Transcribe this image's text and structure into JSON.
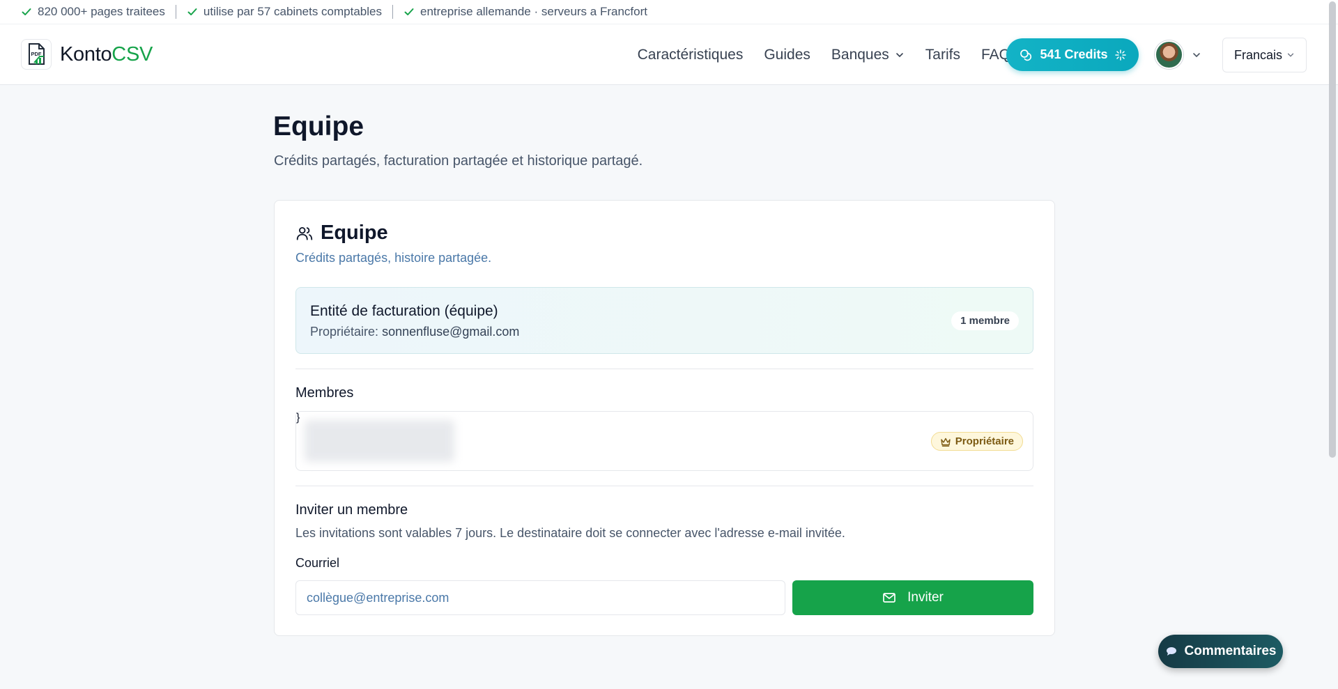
{
  "trustbar": {
    "items": [
      "820 000+ pages traitees",
      "utilise par 57 cabinets comptables",
      "entreprise allemande · serveurs a Francfort"
    ]
  },
  "header": {
    "logo": {
      "part1": "Konto",
      "part2": "CSV",
      "mark": "PDF"
    },
    "nav": [
      {
        "label": "Caractéristiques"
      },
      {
        "label": "Guides"
      },
      {
        "label": "Banques"
      },
      {
        "label": "Tarifs"
      },
      {
        "label": "FAQ"
      }
    ],
    "credits_label": "541 Credits",
    "language": "Francais"
  },
  "page": {
    "title": "Equipe",
    "subtitle": "Crédits partagés, facturation partagée et historique partagé."
  },
  "card": {
    "title": "Equipe",
    "subtitle": "Crédits partagés, histoire partagée.",
    "billing": {
      "title": "Entité de facturation (équipe)",
      "owner_label": "Propriétaire:",
      "owner_email": "sonnenfluse@gmail.com",
      "member_count": "1 membre"
    },
    "members_label": "Membres",
    "owner_badge": "Propriétaire",
    "invite": {
      "title": "Inviter un membre",
      "description": "Les invitations sont valables 7 jours. Le destinataire doit se connecter avec l'adresse e-mail invitée.",
      "field_label": "Courriel",
      "placeholder": "collègue@entreprise.com",
      "button_label": "Inviter"
    }
  },
  "feedback_label": "Commentaires",
  "colors": {
    "accent_green": "#16a34a",
    "credits_teal": "#0aa8bd",
    "feedback_dark": "#153a45"
  }
}
